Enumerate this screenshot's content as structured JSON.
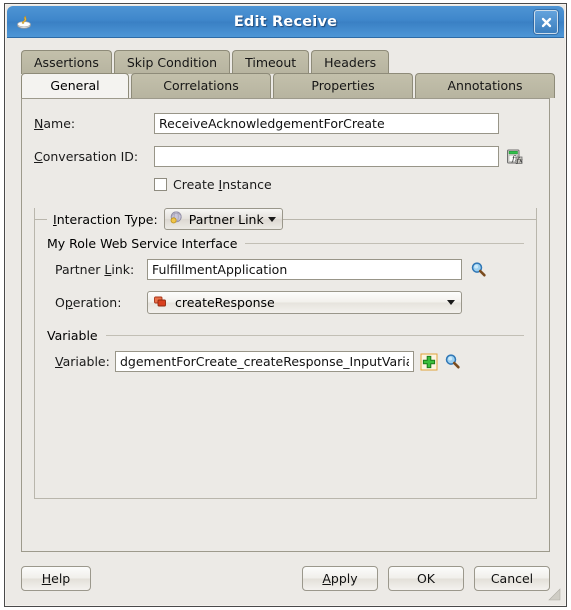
{
  "window": {
    "title": "Edit Receive",
    "app_icon": "jdeveloper-icon",
    "close_label": "✕"
  },
  "tabs": {
    "row1": [
      {
        "label": "Assertions",
        "selected": false
      },
      {
        "label": "Skip Condition",
        "selected": false
      },
      {
        "label": "Timeout",
        "selected": false
      },
      {
        "label": "Headers",
        "selected": false
      }
    ],
    "row2": [
      {
        "label": "General",
        "selected": true
      },
      {
        "label": "Correlations",
        "selected": false
      },
      {
        "label": "Properties",
        "selected": false
      },
      {
        "label": "Annotations",
        "selected": false
      }
    ]
  },
  "general": {
    "name_label_pre": "N",
    "name_label_post": "ame:",
    "name_value": "ReceiveAcknowledgementForCreate",
    "name_placeholder": "",
    "conversation_label_pre": "C",
    "conversation_label_post": "onversation ID:",
    "conversation_value": "",
    "conversation_placeholder": "",
    "expression_icon": "fx-expression-builder-icon",
    "create_instance_label_pre": "Create ",
    "create_instance_label_mn": "I",
    "create_instance_label_post": "nstance",
    "create_instance_checked": false,
    "interaction_group": {
      "title_pre": "I",
      "title_post": "nteraction Type:",
      "value": "Partner Link",
      "value_icon": "partner-link-icon",
      "caret": "chevron-down-icon"
    },
    "my_role_section": "My Role Web Service Interface",
    "partner_link_label_pre": "Partner ",
    "partner_link_label_mn": "L",
    "partner_link_label_post": "ink:",
    "partner_link_value": "FulfillmentApplication",
    "partner_link_browse_icon": "magnifier-icon",
    "operation_label_pre": "O",
    "operation_label_mn": "p",
    "operation_label_post": "eration:",
    "operation_value": "createResponse",
    "operation_icon": "operation-icon",
    "variable_section": "Variable",
    "variable_label_pre": "V",
    "variable_label_post": "ariable:",
    "variable_value": "dgementForCreate_createResponse_InputVariable",
    "variable_add_icon": "add-plus-icon",
    "variable_browse_icon": "magnifier-icon"
  },
  "footer": {
    "help": {
      "pre": "H",
      "post": "elp"
    },
    "apply": {
      "pre": "A",
      "post": "pply"
    },
    "ok": {
      "pre": "",
      "post": "OK"
    },
    "cancel": {
      "pre": "",
      "post": "Cancel"
    },
    "resize_grip": "resize-grip-icon"
  },
  "colors": {
    "titlebar_blue": "#3f87cb",
    "tab_inactive": "#bbb8a4",
    "tab_active": "#f4f3f0",
    "dialog_bg": "#eceae6",
    "accent_green": "#35a035",
    "accent_red": "#d94a2a"
  }
}
